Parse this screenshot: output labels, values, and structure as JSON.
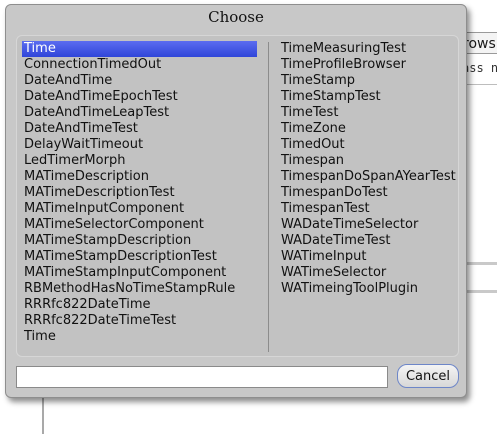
{
  "background": {
    "tab_label": "rows",
    "sub_label": "ass n"
  },
  "dialog": {
    "title": "Choose",
    "selected_color": "#3a4ee0",
    "left_items": [
      "Time",
      "ConnectionTimedOut",
      "DateAndTime",
      "DateAndTimeEpochTest",
      "DateAndTimeLeapTest",
      "DateAndTimeTest",
      "DelayWaitTimeout",
      "LedTimerMorph",
      "MATimeDescription",
      "MATimeDescriptionTest",
      "MATimeInputComponent",
      "MATimeSelectorComponent",
      "MATimeStampDescription",
      "MATimeStampDescriptionTest",
      "MATimeStampInputComponent",
      "RBMethodHasNoTimeStampRule",
      "RRRfc822DateTime",
      "RRRfc822DateTimeTest",
      "Time"
    ],
    "right_items": [
      "TimeMeasuringTest",
      "TimeProfileBrowser",
      "TimeStamp",
      "TimeStampTest",
      "TimeTest",
      "TimeZone",
      "TimedOut",
      "Timespan",
      "TimespanDoSpanAYearTest",
      "TimespanDoTest",
      "TimespanTest",
      "WADateTimeSelector",
      "WADateTimeTest",
      "WATimeInput",
      "WATimeSelector",
      "WATimeingToolPlugin"
    ],
    "filter_value": "",
    "cancel_label": "Cancel"
  }
}
